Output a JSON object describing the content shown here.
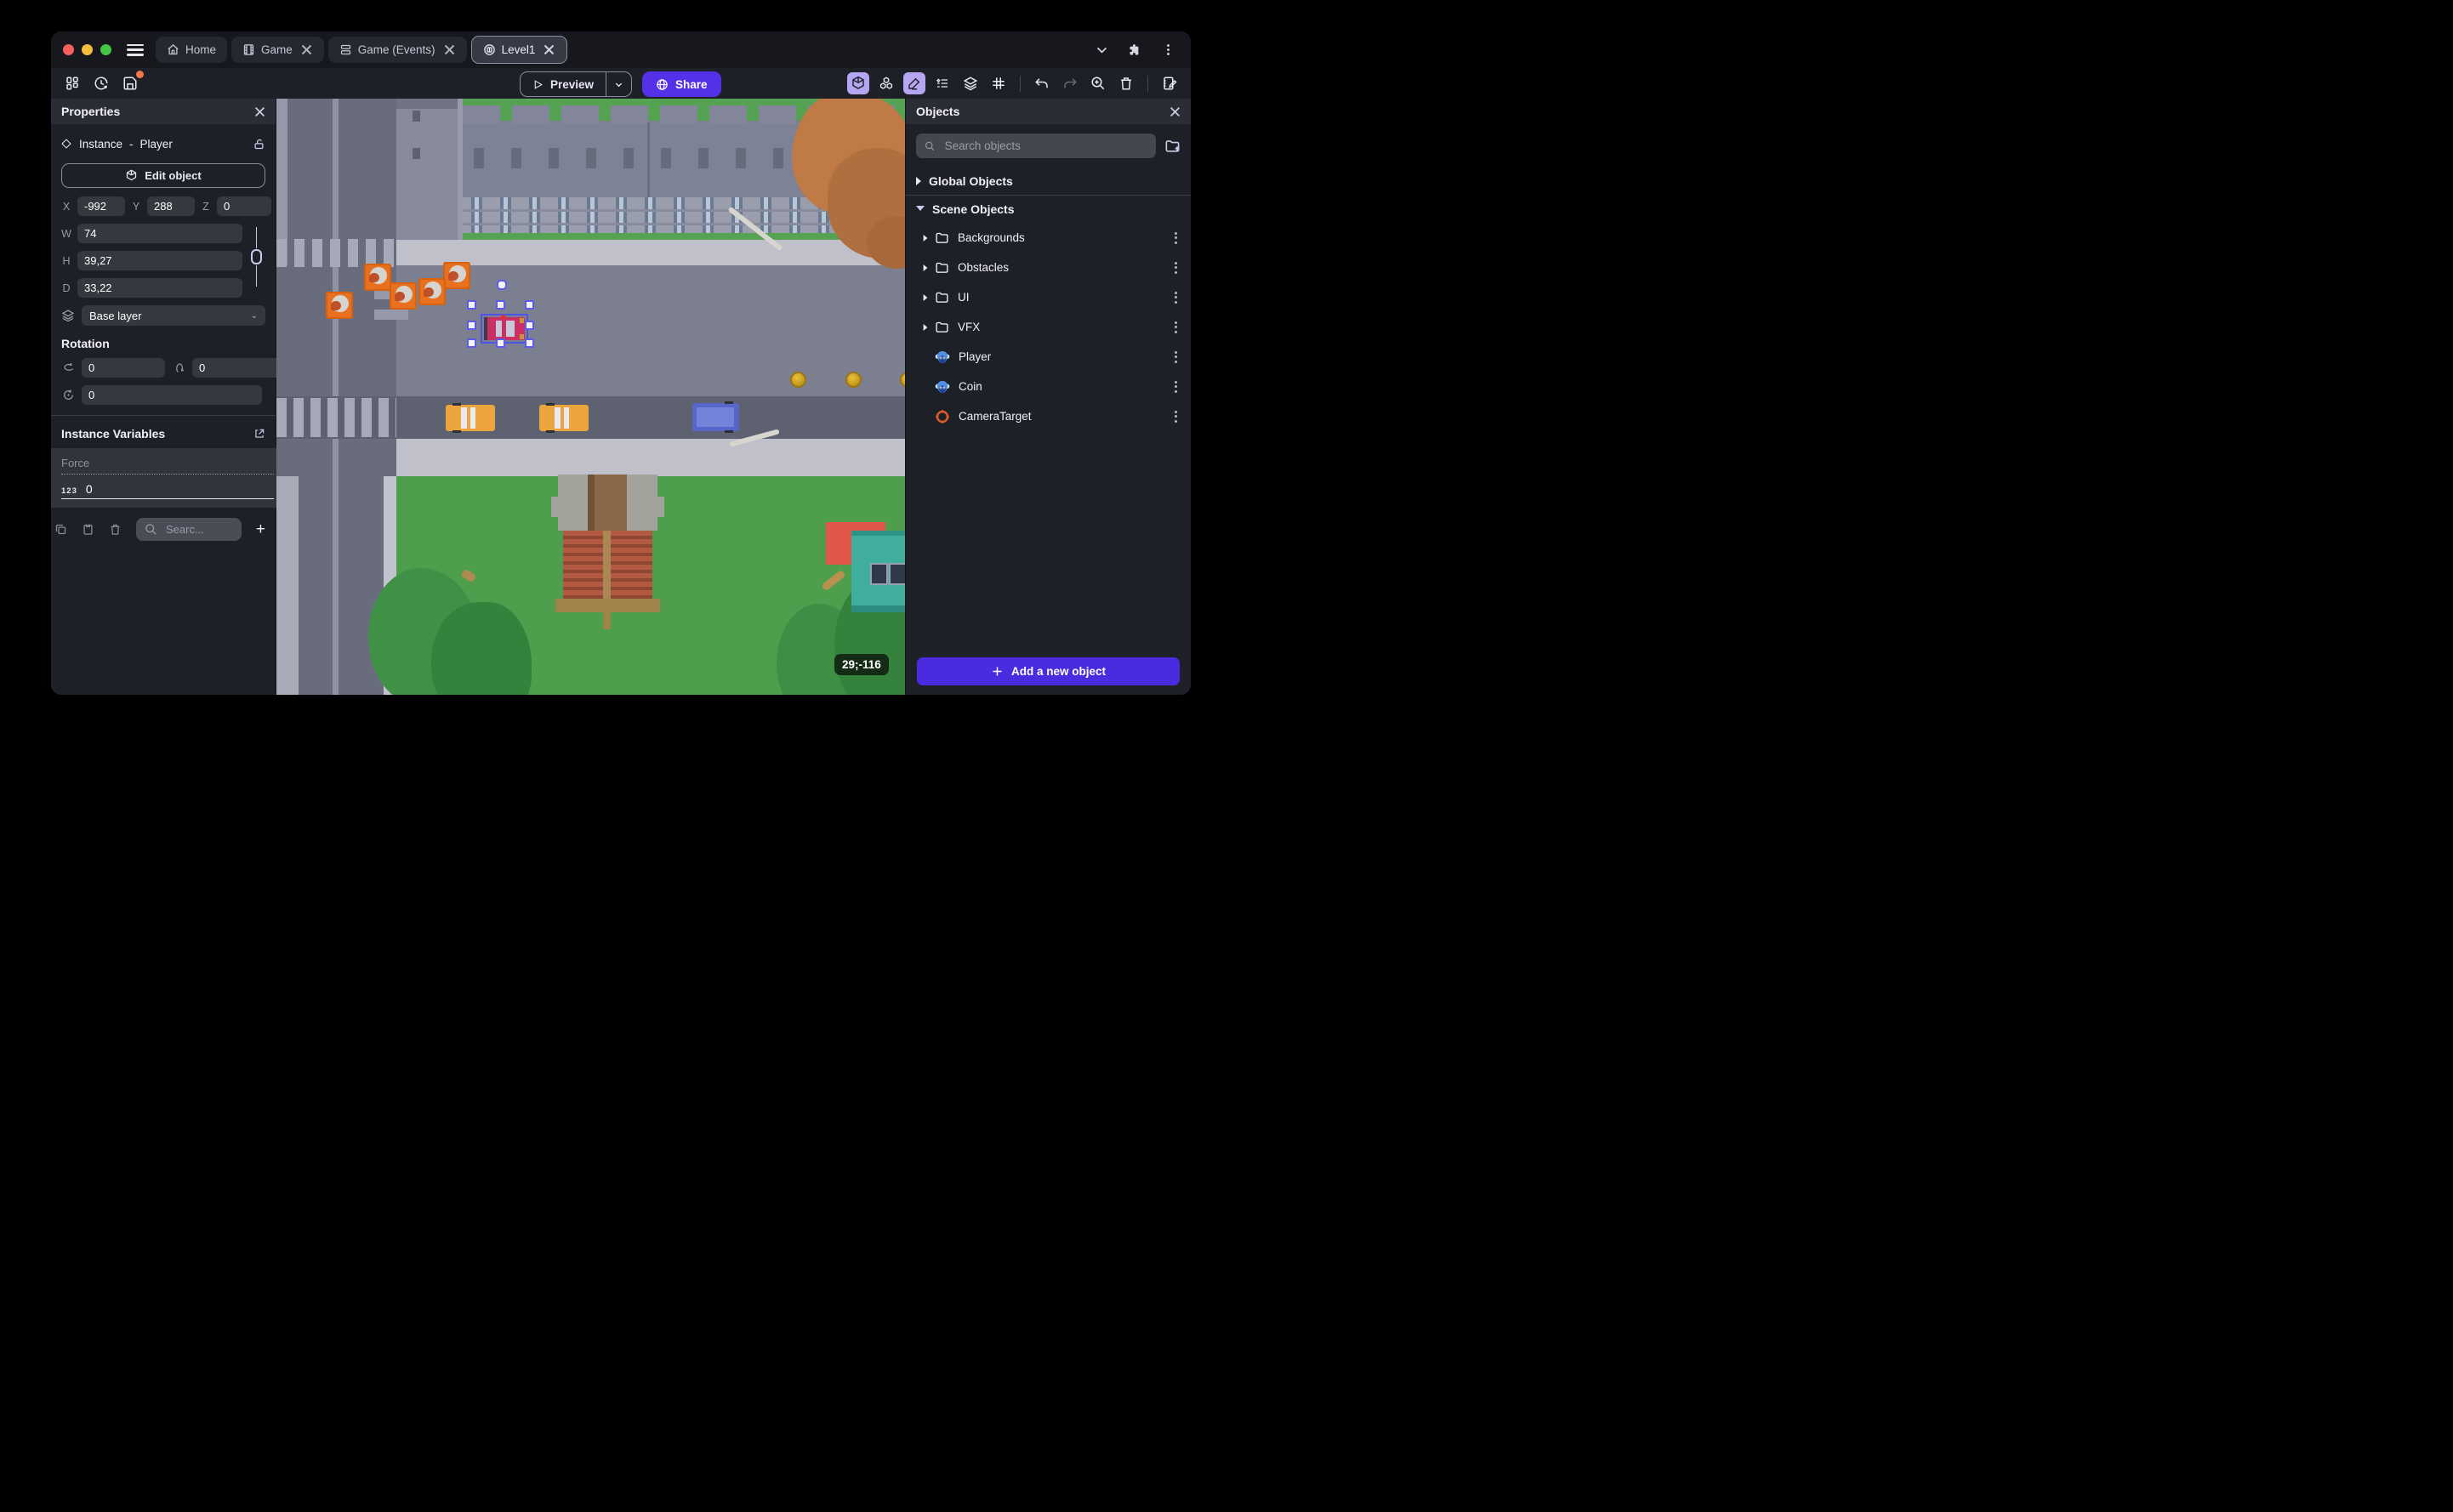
{
  "titlebar": {
    "tabs": [
      {
        "label": "Home"
      },
      {
        "label": "Game"
      },
      {
        "label": "Game (Events)"
      },
      {
        "label": "Level1"
      }
    ]
  },
  "toolbar": {
    "preview_label": "Preview",
    "share_label": "Share"
  },
  "properties": {
    "panel_title": "Properties",
    "instance_type": "Instance",
    "separator": "-",
    "instance_name": "Player",
    "edit_object_label": "Edit object",
    "position": {
      "x_label": "X",
      "x": "-992",
      "y_label": "Y",
      "y": "288",
      "z_label": "Z",
      "z": "0"
    },
    "size": {
      "w_label": "W",
      "w": "74",
      "h_label": "H",
      "h": "39,27",
      "d_label": "D",
      "d": "33,22"
    },
    "layer": "Base layer",
    "rotation_title": "Rotation",
    "rotation": {
      "rx": "0",
      "ry": "0",
      "rz": "0"
    },
    "variables_title": "Instance Variables",
    "variable": {
      "name": "Force",
      "type_badge": "123",
      "value": "0"
    },
    "variables_search_placeholder": "Searc..."
  },
  "objectsPanel": {
    "panel_title": "Objects",
    "search_placeholder": "Search objects",
    "global_group_label": "Global Objects",
    "scene_group_label": "Scene Objects",
    "items": [
      {
        "label": "Backgrounds",
        "kind": "folder"
      },
      {
        "label": "Obstacles",
        "kind": "folder"
      },
      {
        "label": "UI",
        "kind": "folder"
      },
      {
        "label": "VFX",
        "kind": "folder"
      },
      {
        "label": "Player",
        "kind": "object"
      },
      {
        "label": "Coin",
        "kind": "object"
      },
      {
        "label": "CameraTarget",
        "kind": "camera-target"
      }
    ],
    "add_button_label": "Add a new object"
  },
  "viewport": {
    "coordinate_badge": "29;-116"
  },
  "colors": {
    "accent_purple": "#5430e8",
    "toolbar_toggle_active": "#b6a6f2",
    "unsaved_dot": "#f2784b",
    "selection_blue": "#5b5bf0",
    "traffic_red": "#f4605a",
    "traffic_yellow": "#f6bd3b",
    "traffic_green": "#43c645"
  }
}
